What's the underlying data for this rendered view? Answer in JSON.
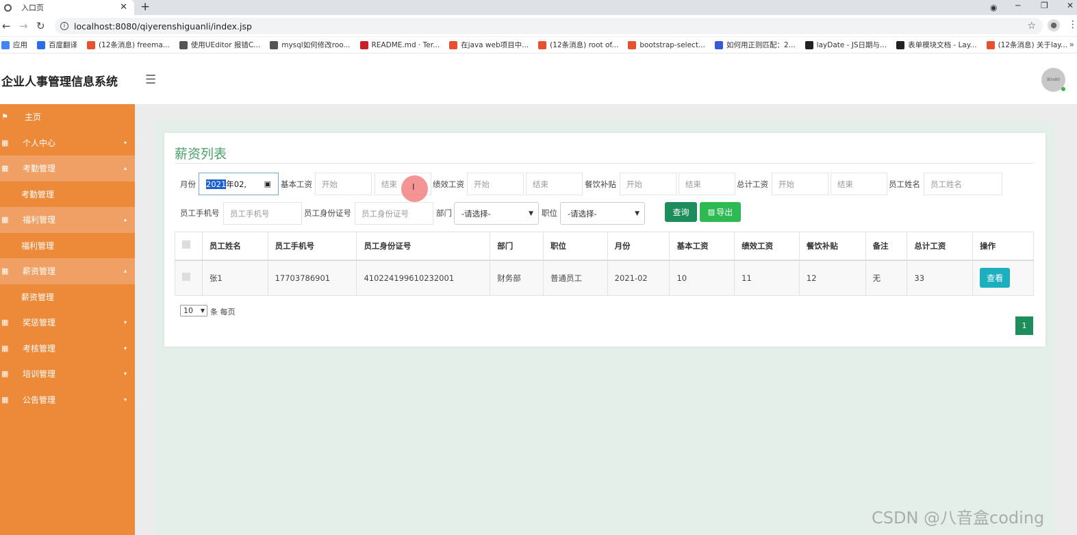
{
  "browser": {
    "tab_title": "入口页",
    "url": "localhost:8080/qiyerenshiguanli/index.jsp",
    "bookmarks": [
      {
        "label": "应用",
        "color": "#4285f4"
      },
      {
        "label": "百度翻译",
        "color": "#2b6de5"
      },
      {
        "label": "(12条消息) freema...",
        "color": "#e8512f"
      },
      {
        "label": "使用UEditor 报错C...",
        "color": "#555555"
      },
      {
        "label": "mysql如何修改roo...",
        "color": "#555555"
      },
      {
        "label": "README.md · Ter...",
        "color": "#c7222a"
      },
      {
        "label": "在java web项目中...",
        "color": "#e8512f"
      },
      {
        "label": "(12条消息) root of...",
        "color": "#e8512f"
      },
      {
        "label": "bootstrap-select...",
        "color": "#e8512f"
      },
      {
        "label": "如何用正则匹配：2...",
        "color": "#3a5bd9"
      },
      {
        "label": "layDate - JS日期与...",
        "color": "#222222"
      },
      {
        "label": "表单模块文档 - Lay...",
        "color": "#222222"
      },
      {
        "label": "(12条消息) 关于lay...",
        "color": "#e8512f"
      }
    ]
  },
  "header": {
    "brand": "企业人事管理信息系统",
    "avatar_text": "80x80"
  },
  "sidebar": {
    "items": [
      {
        "label": "主页",
        "icon": "flag-icon",
        "type": "home"
      },
      {
        "label": "个人中心",
        "icon": "grid-icon",
        "caret": "▾"
      },
      {
        "label": "考勤管理",
        "icon": "grid-icon",
        "caret": "▴",
        "open": true
      },
      {
        "label": "考勤管理",
        "type": "sub"
      },
      {
        "label": "福利管理",
        "icon": "grid-icon",
        "caret": "▴",
        "open": true
      },
      {
        "label": "福利管理",
        "type": "sub"
      },
      {
        "label": "薪资管理",
        "icon": "grid-icon",
        "caret": "▴",
        "open": true
      },
      {
        "label": "薪资管理",
        "type": "sub"
      },
      {
        "label": "奖惩管理",
        "icon": "grid-icon",
        "caret": "▾"
      },
      {
        "label": "考核管理",
        "icon": "grid-icon",
        "caret": "▾"
      },
      {
        "label": "培训管理",
        "icon": "grid-icon",
        "caret": "▾"
      },
      {
        "label": "公告管理",
        "icon": "grid-icon",
        "caret": "▾"
      }
    ]
  },
  "main": {
    "title": "薪资列表",
    "filters": {
      "month_label": "月份",
      "month_value_highlight": "2021",
      "month_value_rest": "年02,",
      "base_label": "基本工资",
      "perf_label": "绩效工资",
      "meal_label": "餐饮补贴",
      "total_label": "总计工资",
      "name_label": "员工姓名",
      "phone_label": "员工手机号",
      "idcard_label": "员工身份证号",
      "dept_label": "部门",
      "pos_label": "职位",
      "start_ph": "开始",
      "end_ph": "结束",
      "name_ph": "员工姓名",
      "phone_ph": "员工手机号",
      "idcard_ph": "员工身份证号",
      "dept_value": "-请选择-",
      "pos_value": "-请选择-",
      "query_btn": "查询",
      "export_btn": "导出"
    },
    "table": {
      "headers": [
        "员工姓名",
        "员工手机号",
        "员工身份证号",
        "部门",
        "职位",
        "月份",
        "基本工资",
        "绩效工资",
        "餐饮补贴",
        "备注",
        "总计工资",
        "操作"
      ],
      "rows": [
        {
          "name": "张1",
          "phone": "17703786901",
          "idcard": "410224199610232001",
          "dept": "财务部",
          "pos": "普通员工",
          "month": "2021-02",
          "base": "10",
          "perf": "11",
          "meal": "12",
          "note": "无",
          "total": "33",
          "action": "查看"
        }
      ]
    },
    "pager": {
      "page_size": "10",
      "page_size_suffix": "条 每页",
      "current_page": "1"
    }
  },
  "watermark": "CSDN @八音盒coding"
}
